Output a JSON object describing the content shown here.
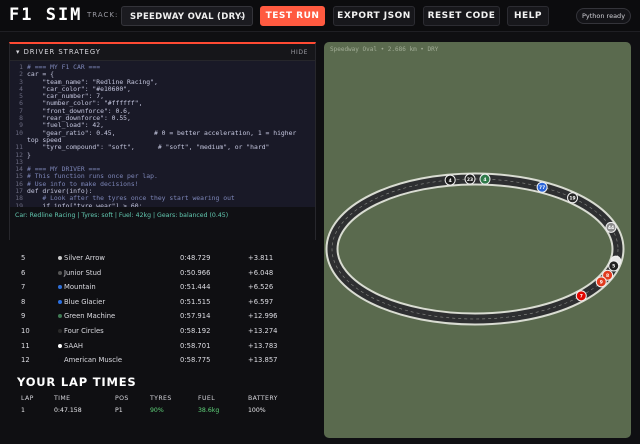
{
  "header": {
    "logo": "F1 SIM",
    "track_label": "TRACK:",
    "track_selected": "SPEEDWAY OVAL (DRY)",
    "test_run": "TEST RUN",
    "export_json": "EXPORT JSON",
    "reset_code": "RESET CODE",
    "help": "HELP",
    "python_status": "Python ready"
  },
  "strategy": {
    "title": "DRIVER STRATEGY",
    "hide": "HIDE",
    "code_lines": [
      {
        "n": "1",
        "t": "# === MY F1 CAR ==="
      },
      {
        "n": "2",
        "t": "car = {"
      },
      {
        "n": "3",
        "t": "    \"team_name\": \"Redline Racing\","
      },
      {
        "n": "4",
        "t": "    \"car_color\": \"#e10600\","
      },
      {
        "n": "5",
        "t": "    \"car_number\": 7,"
      },
      {
        "n": "6",
        "t": "    \"number_color\": \"#ffffff\","
      },
      {
        "n": "7",
        "t": "    \"front_downforce\": 0.6,"
      },
      {
        "n": "8",
        "t": "    \"rear_downforce\": 0.55,"
      },
      {
        "n": "9",
        "t": "    \"fuel_load\": 42,"
      },
      {
        "n": "10",
        "t": "    \"gear_ratio\": 0.45,          # 0 = better acceleration, 1 = higher"
      },
      {
        "n": "",
        "t": "top speed"
      },
      {
        "n": "11",
        "t": "    \"tyre_compound\": \"soft\",      # \"soft\", \"medium\", or \"hard\""
      },
      {
        "n": "12",
        "t": "}"
      },
      {
        "n": "13",
        "t": ""
      },
      {
        "n": "14",
        "t": "# === MY DRIVER ==="
      },
      {
        "n": "15",
        "t": "# This function runs once per lap."
      },
      {
        "n": "16",
        "t": "# Use info to make decisions!"
      },
      {
        "n": "17",
        "t": "def driver(info):"
      },
      {
        "n": "18",
        "t": "    # Look after the tyres once they start wearing out"
      },
      {
        "n": "19",
        "t": "    if info[\"tyre_wear\"] > 60:"
      }
    ],
    "status_line": "Car: Redline Racing | Tyres: soft | Fuel: 42kg | Gears: balanced (0.45)"
  },
  "leaderboard": [
    {
      "pos": "5",
      "name": "Silver Arrow",
      "time": "0:48.729",
      "gap": "+3.811",
      "color": "#c8c8c8"
    },
    {
      "pos": "6",
      "name": "Junior Stud",
      "time": "0:50.966",
      "gap": "+6.048",
      "color": "#555555"
    },
    {
      "pos": "7",
      "name": "Mountain",
      "time": "0:51.444",
      "gap": "+6.526",
      "color": "#2f6fd8"
    },
    {
      "pos": "8",
      "name": "Blue Glacier",
      "time": "0:51.515",
      "gap": "+6.597",
      "color": "#2b6fe0"
    },
    {
      "pos": "9",
      "name": "Green Machine",
      "time": "0:57.914",
      "gap": "+12.996",
      "color": "#3f7a54"
    },
    {
      "pos": "10",
      "name": "Four Circles",
      "time": "0:58.192",
      "gap": "+13.274",
      "color": "#2a2a2a"
    },
    {
      "pos": "11",
      "name": "SAAH",
      "time": "0:58.701",
      "gap": "+13.783",
      "color": "#ffffff"
    },
    {
      "pos": "12",
      "name": "American Muscle",
      "time": "0:58.775",
      "gap": "+13.857",
      "color": "#0f0f12"
    }
  ],
  "lap_times": {
    "title": "YOUR LAP TIMES",
    "headers": [
      "LAP",
      "TIME",
      "POS",
      "TYRES",
      "FUEL",
      "BATTERY"
    ],
    "rows": [
      {
        "lap": "1",
        "time": "0:47.158",
        "pos": "P1",
        "tyres": "90%",
        "fuel": "38.6kg",
        "battery": "100%"
      }
    ]
  },
  "track_view": {
    "caption": "Speedway Oval • 2.686 km • DRY",
    "cars": [
      {
        "num": "4",
        "color": "#1a1a1a"
      },
      {
        "num": "23",
        "color": "#1e1e1e"
      },
      {
        "num": "4",
        "color": "#2f7a4a"
      },
      {
        "num": "77",
        "color": "#2a64d8"
      },
      {
        "num": "19",
        "color": "#2a2a2a"
      },
      {
        "num": "44",
        "color": "#8a8a8a"
      },
      {
        "num": "",
        "color": "#e8e8e8"
      },
      {
        "num": "5",
        "color": "#222222"
      },
      {
        "num": "8",
        "color": "#e03a1e"
      },
      {
        "num": "9",
        "color": "#e03a1e"
      },
      {
        "num": "7",
        "color": "#e10600"
      }
    ]
  }
}
